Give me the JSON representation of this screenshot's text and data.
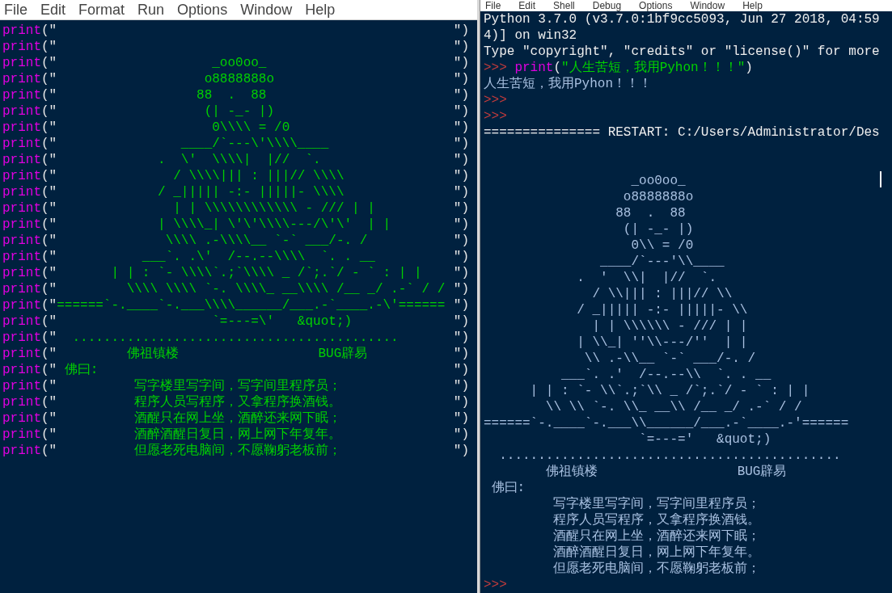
{
  "editor": {
    "menu": [
      "File",
      "Edit",
      "Format",
      "Run",
      "Options",
      "Window",
      "Help"
    ],
    "lines": [
      {
        "keyword": "print",
        "open": "(\"",
        "close": "\")"
      },
      {
        "keyword": "print",
        "open": "(\"",
        "close": "\")"
      },
      {
        "keyword": "print",
        "open": "(\"",
        "text": "                    _oo0oo_",
        "close": "\")"
      },
      {
        "keyword": "print",
        "open": "(\"",
        "text": "                   o8888888o",
        "close": "\")"
      },
      {
        "keyword": "print",
        "open": "(\"",
        "text": "                  88  .  88",
        "close": "\")"
      },
      {
        "keyword": "print",
        "open": "(\"",
        "text": "                   (| -_- |)",
        "close": "\")"
      },
      {
        "keyword": "print",
        "open": "(\"",
        "text": "                    0\\\\\\\\ = /0",
        "close": "\")"
      },
      {
        "keyword": "print",
        "open": "(\"",
        "text": "                ____/`---\\'\\\\\\\\____",
        "close": "\")"
      },
      {
        "keyword": "print",
        "open": "(\"",
        "text": "             .  \\'  \\\\\\\\|  |//  `.",
        "close": "\")"
      },
      {
        "keyword": "print",
        "open": "(\"",
        "text": "               / \\\\\\\\||| : |||// \\\\\\\\",
        "close": "\")"
      },
      {
        "keyword": "print",
        "open": "(\"",
        "text": "             / _||||| -:- |||||- \\\\\\\\",
        "close": "\")"
      },
      {
        "keyword": "print",
        "open": "(\"",
        "text": "               | | \\\\\\\\\\\\\\\\\\\\\\\\ - /// | |",
        "close": "\")"
      },
      {
        "keyword": "print",
        "open": "(\"",
        "text": "             | \\\\\\\\_| \\'\\'\\\\\\\\---/\\'\\'  | |",
        "close": "\")"
      },
      {
        "keyword": "print",
        "open": "(\"",
        "text": "              \\\\\\\\ .-\\\\\\\\__ `-` ___/-. /",
        "close": "\")"
      },
      {
        "keyword": "print",
        "open": "(\"",
        "text": "           ___`. .\\'  /--.--\\\\\\\\  `. . __",
        "close": "\")"
      },
      {
        "keyword": "print",
        "open": "(\"",
        "text": "       | | : `- \\\\\\\\`.;`\\\\\\\\ _ /`;.`/ - ` : | |",
        "close": "\")"
      },
      {
        "keyword": "print",
        "open": "(\"",
        "text": "         \\\\\\\\ \\\\\\\\ `-. \\\\\\\\_ __\\\\\\\\ /__ _/ .-` / /",
        "close": "\")"
      },
      {
        "keyword": "print",
        "open": "(\"",
        "text": "======`-.____`-.___\\\\\\\\______/___.-`____.-\\'======",
        "close": "\")"
      },
      {
        "keyword": "print",
        "open": "(\"",
        "text": "                    `=---=\\'   &quot;)",
        "close": "\")"
      },
      {
        "keyword": "print",
        "open": "(\"",
        "text": "  ..........................................",
        "close": "\")"
      },
      {
        "keyword": "print",
        "open": "(\"",
        "text": "         佛祖镇楼                  BUG辟易",
        "close": "\")"
      },
      {
        "keyword": "print",
        "open": "(\"",
        "text": " 佛曰:",
        "close": "\")"
      },
      {
        "keyword": "print",
        "open": "(\"",
        "text": "          写字楼里写字间，写字间里程序员；",
        "close": "\")"
      },
      {
        "keyword": "print",
        "open": "(\"",
        "text": "          程序人员写程序，又拿程序换酒钱。",
        "close": "\")"
      },
      {
        "keyword": "print",
        "open": "(\"",
        "text": "          酒醒只在网上坐，酒醉还来网下眠；",
        "close": "\")"
      },
      {
        "keyword": "print",
        "open": "(\"",
        "text": "          酒醉酒醒日复日，网上网下年复年。",
        "close": "\")"
      },
      {
        "keyword": "print",
        "open": "(\"",
        "text": "          但愿老死电脑间，不愿鞠躬老板前；",
        "close": "\")"
      }
    ]
  },
  "shell": {
    "menu": [
      "File",
      "Edit",
      "Shell",
      "Debug",
      "Options",
      "Window",
      "Help"
    ],
    "lines": [
      {
        "kind": "info",
        "text": "Python 3.7.0 (v3.7.0:1bf9cc5093, Jun 27 2018, 04:59"
      },
      {
        "kind": "info",
        "text": "4)] on win32"
      },
      {
        "kind": "info",
        "text": "Type \"copyright\", \"credits\" or \"license()\" for more"
      },
      {
        "kind": "input",
        "prompt": ">>>",
        "keyword": "print",
        "open": "(",
        "string": "\"人生苦短，我用Pyhon！！！\"",
        "close": ")"
      },
      {
        "kind": "stdout",
        "text": "人生苦短，我用Pyhon！！！"
      },
      {
        "kind": "prompt",
        "prompt": ">>>"
      },
      {
        "kind": "prompt",
        "prompt": ">>>"
      },
      {
        "kind": "info",
        "text": "=============== RESTART: C:/Users/Administrator/Des"
      },
      {
        "kind": "blank"
      },
      {
        "kind": "blank"
      },
      {
        "kind": "stdout",
        "text": "                   _oo0oo_"
      },
      {
        "kind": "stdout",
        "text": "                  o8888888o"
      },
      {
        "kind": "stdout",
        "text": "                 88  .  88"
      },
      {
        "kind": "stdout",
        "text": "                  (| -_- |)"
      },
      {
        "kind": "stdout",
        "text": "                   0\\\\ = /0"
      },
      {
        "kind": "stdout",
        "text": "               ____/`---'\\\\____"
      },
      {
        "kind": "stdout",
        "text": "            .  '  \\\\|  |//  `."
      },
      {
        "kind": "stdout",
        "text": "              / \\\\||| : |||// \\\\"
      },
      {
        "kind": "stdout",
        "text": "            / _||||| -:- |||||- \\\\"
      },
      {
        "kind": "stdout",
        "text": "              | | \\\\\\\\\\\\ - /// | |"
      },
      {
        "kind": "stdout",
        "text": "            | \\\\_| ''\\\\---/''  | |"
      },
      {
        "kind": "stdout",
        "text": "             \\\\ .-\\\\__ `-` ___/-. /"
      },
      {
        "kind": "stdout",
        "text": "          ___`. .'  /--.--\\\\  `. . __"
      },
      {
        "kind": "stdout",
        "text": "      | | : `- \\\\`.;`\\\\ _ /`;.`/ - ` : | |"
      },
      {
        "kind": "stdout",
        "text": "        \\\\ \\\\ `-. \\\\_ __\\\\ /__ _/ .-` / /"
      },
      {
        "kind": "stdout",
        "text": "======`-.____`-.___\\\\______/___.-`____.-'======"
      },
      {
        "kind": "stdout",
        "text": "                    `=---='   &quot;)"
      },
      {
        "kind": "stdout",
        "text": "  ............................................"
      },
      {
        "kind": "stdout",
        "text": "        佛祖镇楼                  BUG辟易"
      },
      {
        "kind": "stdout",
        "text": " 佛曰:"
      },
      {
        "kind": "stdout",
        "text": "         写字楼里写字间，写字间里程序员；"
      },
      {
        "kind": "stdout",
        "text": "         程序人员写程序，又拿程序换酒钱。"
      },
      {
        "kind": "stdout",
        "text": "         酒醒只在网上坐，酒醉还来网下眠；"
      },
      {
        "kind": "stdout",
        "text": "         酒醉酒醒日复日，网上网下年复年。"
      },
      {
        "kind": "stdout",
        "text": "         但愿老死电脑间，不愿鞠躬老板前；"
      },
      {
        "kind": "prompt",
        "prompt": ">>>"
      }
    ]
  }
}
